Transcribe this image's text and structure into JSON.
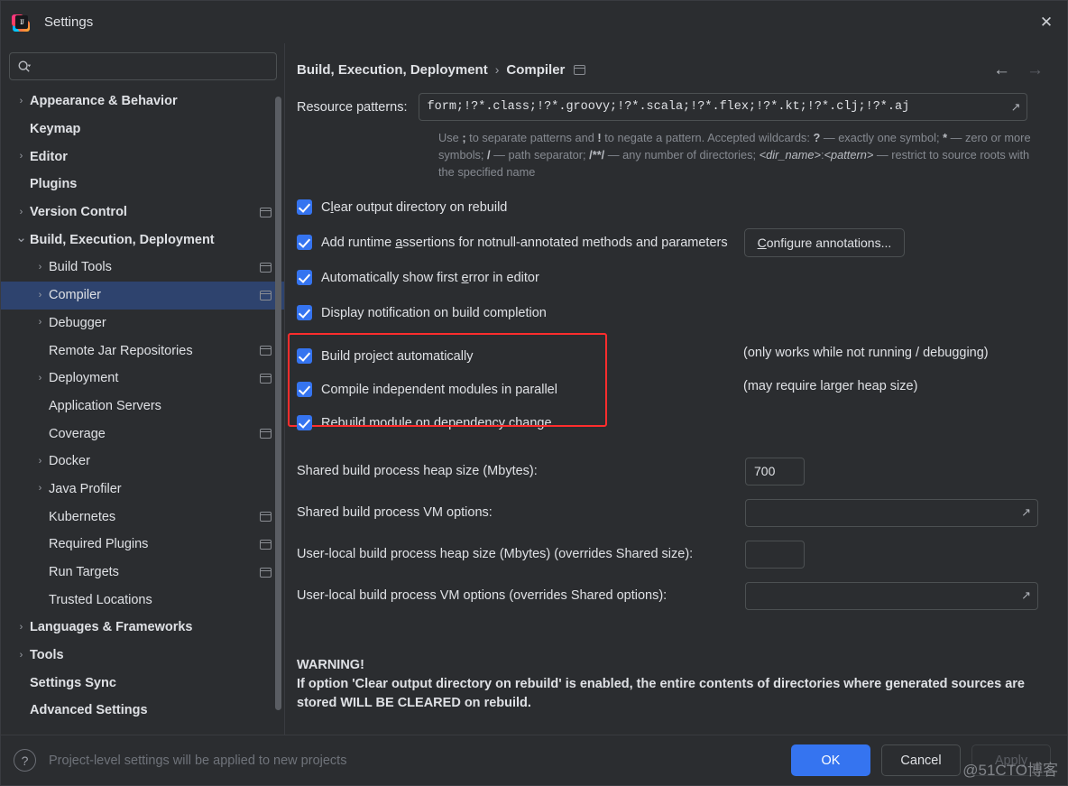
{
  "window": {
    "title": "Settings",
    "logo_icon": "intellij-idea-logo",
    "close_icon": "close-icon"
  },
  "sidebar": {
    "search": {
      "placeholder": "",
      "value": "",
      "icon": "search-icon"
    },
    "items": [
      {
        "label": "Appearance & Behavior",
        "level": 0,
        "twisty": "chevron-right",
        "module": false,
        "selected": false
      },
      {
        "label": "Keymap",
        "level": 0,
        "twisty": "",
        "module": false,
        "selected": false
      },
      {
        "label": "Editor",
        "level": 0,
        "twisty": "chevron-right",
        "module": false,
        "selected": false
      },
      {
        "label": "Plugins",
        "level": 0,
        "twisty": "",
        "module": false,
        "selected": false
      },
      {
        "label": "Version Control",
        "level": 0,
        "twisty": "chevron-right",
        "module": true,
        "selected": false
      },
      {
        "label": "Build, Execution, Deployment",
        "level": 0,
        "twisty": "chevron-down",
        "module": false,
        "selected": false
      },
      {
        "label": "Build Tools",
        "level": 1,
        "twisty": "chevron-right",
        "module": true,
        "selected": false
      },
      {
        "label": "Compiler",
        "level": 1,
        "twisty": "chevron-right",
        "module": true,
        "selected": true
      },
      {
        "label": "Debugger",
        "level": 1,
        "twisty": "chevron-right",
        "module": false,
        "selected": false
      },
      {
        "label": "Remote Jar Repositories",
        "level": 1,
        "twisty": "",
        "module": true,
        "selected": false
      },
      {
        "label": "Deployment",
        "level": 1,
        "twisty": "chevron-right",
        "module": true,
        "selected": false
      },
      {
        "label": "Application Servers",
        "level": 1,
        "twisty": "",
        "module": false,
        "selected": false
      },
      {
        "label": "Coverage",
        "level": 1,
        "twisty": "",
        "module": true,
        "selected": false
      },
      {
        "label": "Docker",
        "level": 1,
        "twisty": "chevron-right",
        "module": false,
        "selected": false
      },
      {
        "label": "Java Profiler",
        "level": 1,
        "twisty": "chevron-right",
        "module": false,
        "selected": false
      },
      {
        "label": "Kubernetes",
        "level": 1,
        "twisty": "",
        "module": true,
        "selected": false
      },
      {
        "label": "Required Plugins",
        "level": 1,
        "twisty": "",
        "module": true,
        "selected": false
      },
      {
        "label": "Run Targets",
        "level": 1,
        "twisty": "",
        "module": true,
        "selected": false
      },
      {
        "label": "Trusted Locations",
        "level": 1,
        "twisty": "",
        "module": false,
        "selected": false
      },
      {
        "label": "Languages & Frameworks",
        "level": 0,
        "twisty": "chevron-right",
        "module": false,
        "selected": false
      },
      {
        "label": "Tools",
        "level": 0,
        "twisty": "chevron-right",
        "module": false,
        "selected": false
      },
      {
        "label": "Settings Sync",
        "level": 0,
        "twisty": "",
        "module": false,
        "selected": false
      },
      {
        "label": "Advanced Settings",
        "level": 0,
        "twisty": "",
        "module": false,
        "selected": false
      }
    ]
  },
  "main": {
    "breadcrumb": {
      "parent": "Build, Execution, Deployment",
      "separator": "›",
      "current": "Compiler",
      "module_icon": "project-level-settings-icon"
    },
    "nav": {
      "back_icon": "arrow-left-icon",
      "forward_icon": "arrow-right-icon"
    },
    "resource_patterns": {
      "label": "Resource patterns:",
      "value": "form;!?*.class;!?*.groovy;!?*.scala;!?*.flex;!?*.kt;!?*.clj;!?*.aj",
      "expand_icon": "expand-editor-icon"
    },
    "hint_html": "Use <b>;</b> to separate patterns and <b>!</b> to negate a pattern. Accepted wildcards: <b>?</b> &mdash; exactly one symbol; <b>*</b> &mdash; zero or more symbols; <b>/</b> &mdash; path separator; <b>/**/</b> &mdash; any number of directories; <i>&lt;dir_name&gt;</i>:<i>&lt;pattern&gt;</i> &mdash; restrict to source roots with the specified name",
    "checkboxes_top": [
      {
        "label_html": "C<u>l</u>ear output directory on rebuild",
        "checked": true,
        "button": null
      },
      {
        "label_html": "Add runtime <u>a</u>ssertions for notnull-annotated methods and parameters",
        "checked": true,
        "button": "<u>C</u>onfigure annotations..."
      },
      {
        "label_html": "Automatically show first <u>e</u>rror in editor",
        "checked": true,
        "button": null
      },
      {
        "label_html": "Display notification on build completion",
        "checked": true,
        "button": null
      }
    ],
    "highlighted_group": {
      "highlight_color": "#ff2d2d",
      "checkboxes": [
        {
          "label_html": "Build project automatically",
          "checked": true
        },
        {
          "label_html": "Compile independent modules in parallel",
          "checked": true
        },
        {
          "label_html": "Rebuild module on dependency change",
          "checked": true
        }
      ],
      "notes": [
        "(only works while not running / debugging)",
        "(may require larger heap size)"
      ]
    },
    "fields": [
      {
        "label": "Shared build process heap size (Mbytes):",
        "value": "700",
        "type": "number",
        "expand_icon": null
      },
      {
        "label": "Shared build process VM options:",
        "value": "",
        "type": "text",
        "expand_icon": "expand-editor-icon"
      },
      {
        "label": "User-local build process heap size (Mbytes) (overrides Shared size):",
        "value": "",
        "type": "number",
        "expand_icon": null
      },
      {
        "label": "User-local build process VM options (overrides Shared options):",
        "value": "",
        "type": "text",
        "expand_icon": "expand-editor-icon"
      }
    ],
    "warning": {
      "title": "WARNING!",
      "body": "If option 'Clear output directory on rebuild' is enabled, the entire contents of directories where generated sources are stored WILL BE CLEARED on rebuild."
    }
  },
  "footer": {
    "help_icon": "help-icon",
    "note": "Project-level settings will be applied to new projects",
    "buttons": {
      "ok": "OK",
      "cancel": "Cancel",
      "apply": "Apply"
    }
  },
  "watermark": "@51CTO博客",
  "colors": {
    "accent": "#3574f0",
    "selection": "#2e436e",
    "highlight": "#ff2d2d",
    "background": "#2b2d30",
    "text": "#dfe1e5"
  }
}
